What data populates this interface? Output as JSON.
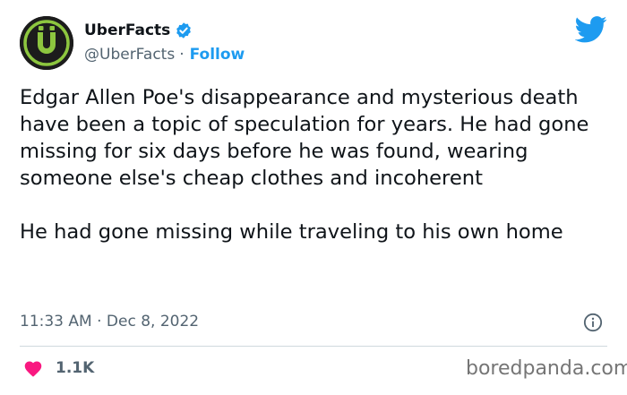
{
  "author": {
    "display_name": "UberFacts",
    "handle": "@UberFacts",
    "separator": "·",
    "follow_label": "Follow",
    "avatar_letter": "Ü",
    "verified": true
  },
  "tweet": {
    "paragraphs": [
      "Edgar Allen Poe's disappearance and mysterious death have been a topic of speculation for years. He had gone missing for six days before he was found, wearing someone else's cheap clothes and incoherent",
      "He had gone missing while traveling to his own home"
    ],
    "timestamp": "11:33 AM · Dec 8, 2022"
  },
  "engagement": {
    "like_count": "1.1K"
  },
  "watermark": "boredpanda.com",
  "icons": {
    "verified": "verified-badge-icon",
    "platform": "twitter-bird-icon",
    "info": "info-icon",
    "like": "heart-icon"
  },
  "colors": {
    "accent": "#1d9bf0",
    "heart": "#f91880",
    "avatar_ring": "#8dc63f",
    "muted_text": "#536471",
    "text": "#0f1419"
  }
}
